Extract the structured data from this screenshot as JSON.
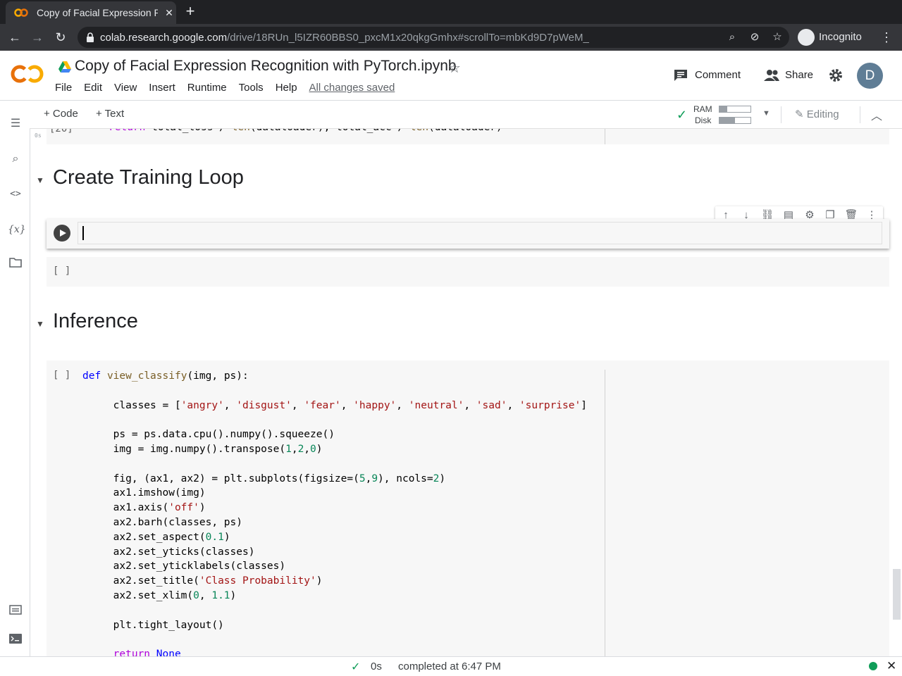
{
  "browser": {
    "tab_title": "Copy of Facial Expression Recognition with PyTorch.ipynb - Colaboratory",
    "url_host": "colab.research.google.com",
    "url_path": "/drive/18RUn_l5IZR60BBS0_pxcM1x20qkgGmhx#scrollTo=mbKd9D7pWeM_",
    "incognito_label": "Incognito"
  },
  "header": {
    "notebook_title": "Copy of Facial Expression Recognition with PyTorch.ipynb",
    "menu": [
      "File",
      "Edit",
      "View",
      "Insert",
      "Runtime",
      "Tools",
      "Help"
    ],
    "saved_status": "All changes saved",
    "comment_label": "Comment",
    "share_label": "Share",
    "avatar_letter": "D"
  },
  "subbar": {
    "add_code": "+ Code",
    "add_text": "+ Text",
    "ram_label": "RAM",
    "disk_label": "Disk",
    "ram_usage": 0.25,
    "disk_usage": 0.5,
    "editing_label": "Editing"
  },
  "notebook": {
    "prev_exec_count": "[20]",
    "prev_exec_time": "0s",
    "section1_title": "Create Training Loop",
    "empty_cell_exec": "[ ]",
    "section2_title": "Inference",
    "code_cell_exec": "[ ]"
  },
  "status": {
    "duration": "0s",
    "message": "completed at 6:47 PM"
  },
  "colors": {
    "brand_orange": "#f9ab00",
    "ok_green": "#0f9d58"
  }
}
